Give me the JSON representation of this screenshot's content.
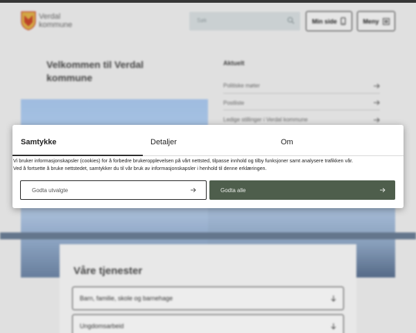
{
  "header": {
    "logo_line1": "Verdal",
    "logo_line2": "kommune",
    "search_placeholder": "Søk",
    "minside_label": "Min side",
    "meny_label": "Meny"
  },
  "welcome": {
    "title": "Velkommen til Verdal kommune"
  },
  "news": {
    "heading": "Aktuelt",
    "items": [
      {
        "label": "Politiske møter"
      },
      {
        "label": "Postliste"
      },
      {
        "label": "Ledige stillinger i Verdal kommune"
      }
    ]
  },
  "services": {
    "heading": "Våre tjenester",
    "items": [
      {
        "label": "Barn, familie, skole og barnehage"
      },
      {
        "label": "Ungdomsarbeid"
      }
    ]
  },
  "consent": {
    "tabs": [
      "Samtykke",
      "Detaljer",
      "Om"
    ],
    "text_line1": "Vi bruker informasjonskapsler (cookies) for å forbedre brukeropplevelsen på vårt nettsted, tilpasse innhold og tilby funksjoner samt analysere trafikken vår.",
    "text_line2": "Ved å fortsette å bruke nettstedet, samtykker du til vår bruk av informasjonskapsler i henhold til denne erklæringen.",
    "btn_selected": "Godta utvalgte",
    "btn_all": "Godta alle"
  },
  "colors": {
    "accept_all_bg": "#4e5e4c",
    "hero_sky": "#a9c8ef",
    "search_bg": "#d7dee0"
  },
  "icons": {
    "crest": "verdal-crest-icon",
    "search": "search-icon",
    "phone": "phone-icon",
    "menu": "menu-icon",
    "arrow_right": "arrow-right-icon",
    "arrow_down": "arrow-down-icon"
  }
}
